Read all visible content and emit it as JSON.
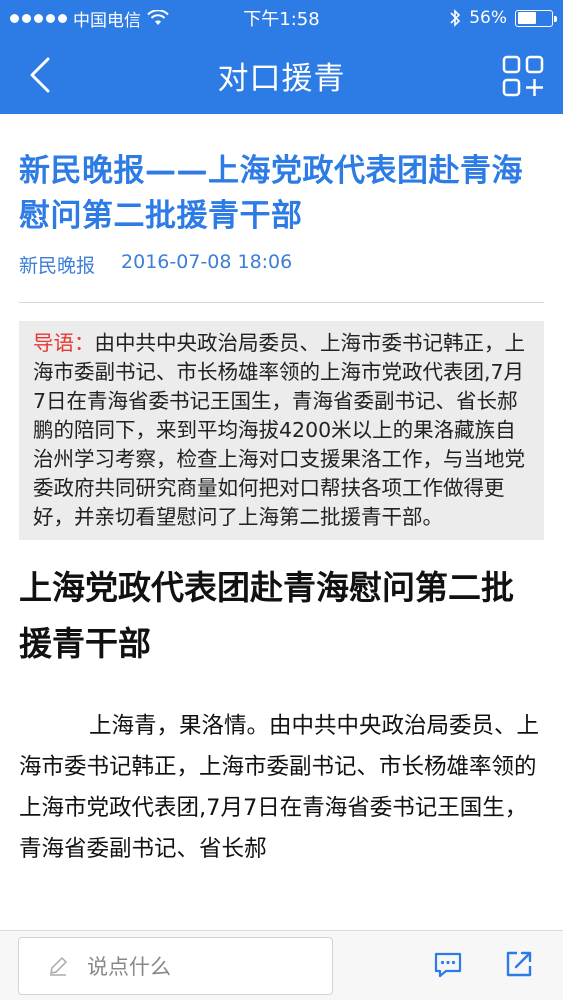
{
  "status": {
    "carrier": "中国电信",
    "time": "下午1:58",
    "battery": "56%",
    "battery_level": 0.56
  },
  "nav": {
    "title": "对口援青"
  },
  "article": {
    "title": "新民晚报——上海党政代表团赴青海 慰问第二批援青干部",
    "source": "新民晚报",
    "datetime": "2016-07-08 18:06",
    "summary_label": "导语：",
    "summary_text": "由中共中央政治局委员、上海市委书记韩正，上海市委副书记、市长杨雄率领的上海市党政代表团,7月7日在青海省委书记王国生，青海省委副书记、省长郝鹏的陪同下，来到平均海拔4200米以上的果洛藏族自治州学习考察，检查上海对口支援果洛工作，与当地党委政府共同研究商量如何把对口帮扶各项工作做得更好，并亲切看望慰问了上海第二批援青干部。",
    "sub_heading": "上海党政代表团赴青海慰问第二批援青干部",
    "body": "上海青，果洛情。由中共中央政治局委员、上海市委书记韩正，上海市委副书记、市长杨雄率领的上海市党政代表团,7月7日在青海省委书记王国生，青海省委副书记、省长郝"
  },
  "bottom": {
    "comment_placeholder": "说点什么"
  },
  "colors": {
    "accent": "#2d7be5",
    "summary_label": "#e53935",
    "summary_bg": "#ececec"
  },
  "icons": {
    "back": "chevron-left-icon",
    "grid": "grid-plus-icon",
    "pencil": "pencil-icon",
    "comment": "comment-icon",
    "share": "share-icon",
    "wifi": "wifi-icon",
    "bluetooth": "bluetooth-icon",
    "battery": "battery-icon"
  }
}
